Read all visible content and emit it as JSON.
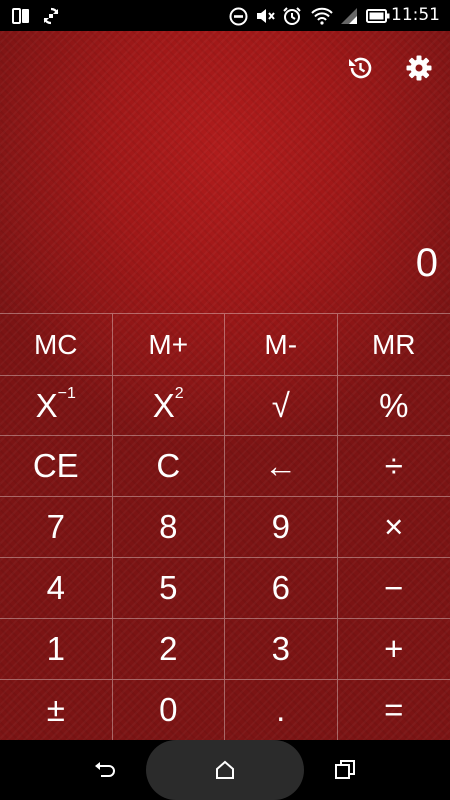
{
  "status_bar": {
    "time": "11:51",
    "left_icons": [
      "screen-mirror-icon",
      "sync-icon"
    ],
    "right_icons": [
      "do-not-disturb-icon",
      "mute-icon",
      "alarm-icon",
      "wifi-icon",
      "signal-icon",
      "battery-icon"
    ]
  },
  "toolbar": {
    "history_icon": "history-icon",
    "settings_icon": "gear-icon"
  },
  "display": {
    "value": "0"
  },
  "keypad": {
    "keys": [
      {
        "label": "MC",
        "name": "memory-clear-button"
      },
      {
        "label": "M+",
        "name": "memory-add-button"
      },
      {
        "label": "M-",
        "name": "memory-subtract-button"
      },
      {
        "label": "MR",
        "name": "memory-recall-button"
      },
      {
        "label": "X",
        "sup": "−1",
        "name": "reciprocal-button"
      },
      {
        "label": "X",
        "sup": "2",
        "name": "square-button"
      },
      {
        "label": "√",
        "name": "square-root-button"
      },
      {
        "label": "%",
        "name": "percent-button"
      },
      {
        "label": "CE",
        "name": "clear-entry-button"
      },
      {
        "label": "C",
        "name": "clear-button"
      },
      {
        "label": "←",
        "name": "backspace-button"
      },
      {
        "label": "÷",
        "name": "divide-button"
      },
      {
        "label": "7",
        "name": "digit-7-button"
      },
      {
        "label": "8",
        "name": "digit-8-button"
      },
      {
        "label": "9",
        "name": "digit-9-button"
      },
      {
        "label": "×",
        "name": "multiply-button"
      },
      {
        "label": "4",
        "name": "digit-4-button"
      },
      {
        "label": "5",
        "name": "digit-5-button"
      },
      {
        "label": "6",
        "name": "digit-6-button"
      },
      {
        "label": "−",
        "name": "subtract-button"
      },
      {
        "label": "1",
        "name": "digit-1-button"
      },
      {
        "label": "2",
        "name": "digit-2-button"
      },
      {
        "label": "3",
        "name": "digit-3-button"
      },
      {
        "label": "+",
        "name": "add-button"
      },
      {
        "label": "±",
        "name": "plus-minus-button"
      },
      {
        "label": "0",
        "name": "digit-0-button"
      },
      {
        "label": ".",
        "name": "decimal-button"
      },
      {
        "label": "=",
        "name": "equals-button"
      }
    ]
  },
  "nav_bar": {
    "icons": [
      "back-icon",
      "home-icon",
      "recents-icon"
    ]
  },
  "colors": {
    "background": "#a01818",
    "text": "#ffffff",
    "grid_line": "#d88a8a"
  }
}
